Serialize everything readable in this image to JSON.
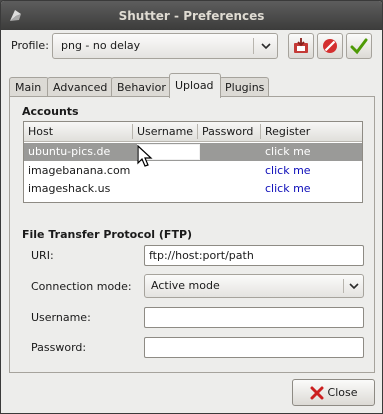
{
  "window": {
    "title": "Shutter - Preferences"
  },
  "profile": {
    "label": "Profile:",
    "selected": "png - no delay"
  },
  "tabs": [
    {
      "label": "Main",
      "active": false
    },
    {
      "label": "Advanced",
      "active": false
    },
    {
      "label": "Behavior",
      "active": false
    },
    {
      "label": "Upload",
      "active": true
    },
    {
      "label": "Plugins",
      "active": false
    }
  ],
  "accounts": {
    "title": "Accounts",
    "columns": [
      "Host",
      "Username",
      "Password",
      "Register"
    ],
    "rows": [
      {
        "host": "ubuntu-pics.de",
        "username": "",
        "password": "",
        "register": "click me",
        "selected": true
      },
      {
        "host": "imagebanana.com",
        "username": "",
        "password": "",
        "register": "click me",
        "selected": false
      },
      {
        "host": "imageshack.us",
        "username": "",
        "password": "",
        "register": "click me",
        "selected": false
      }
    ]
  },
  "ftp": {
    "title": "File Transfer Protocol (FTP)",
    "uri_label": "URI:",
    "uri_value": "ftp://host:port/path",
    "mode_label": "Connection mode:",
    "mode_value": "Active mode",
    "username_label": "Username:",
    "username_value": "",
    "password_label": "Password:",
    "password_value": ""
  },
  "footer": {
    "close_label": "Close"
  },
  "colors": {
    "titlebar": "#3c3c3b",
    "selection": "#9a9a98",
    "link": "#0b0bb8",
    "window_bg": "#ededeb"
  }
}
